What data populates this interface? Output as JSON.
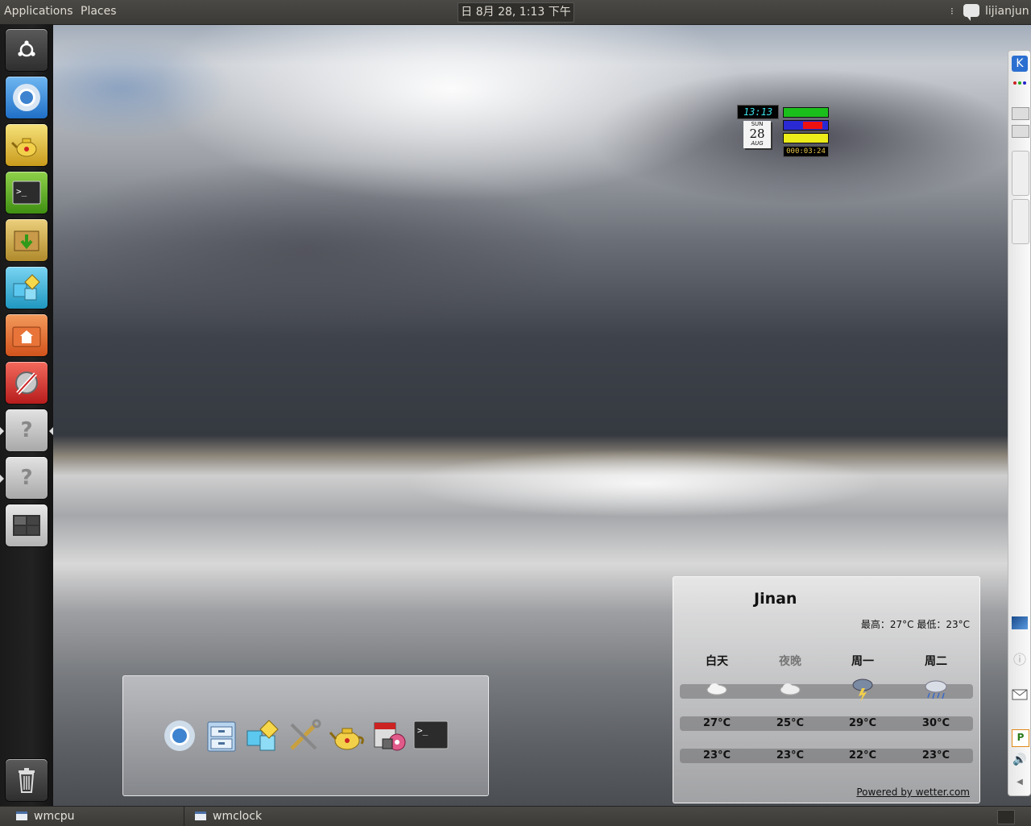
{
  "top_panel": {
    "menu_applications": "Applications",
    "menu_places": "Places",
    "clock": "日 8月 28, 1:13 下午",
    "user": "lijianjun"
  },
  "launcher": {
    "items": [
      {
        "name": "dash-home",
        "icon": "ubuntu-logo-icon"
      },
      {
        "name": "chromium",
        "icon": "chromium-icon"
      },
      {
        "name": "teapot",
        "icon": "teapot-icon"
      },
      {
        "name": "terminal",
        "icon": "terminal-icon"
      },
      {
        "name": "archive-manager",
        "icon": "package-download-icon"
      },
      {
        "name": "workspace-switcher",
        "icon": "shapes-icon"
      },
      {
        "name": "home-folder",
        "icon": "home-folder-icon"
      },
      {
        "name": "settings",
        "icon": "settings-wrench-icon"
      },
      {
        "name": "unknown-app-1",
        "icon": "question-mark-icon"
      },
      {
        "name": "unknown-app-2",
        "icon": "question-mark-icon"
      },
      {
        "name": "workspaces",
        "icon": "workspaces-icon"
      },
      {
        "name": "trash",
        "icon": "trash-icon"
      }
    ]
  },
  "wmclock": {
    "time": "13:13",
    "day": "SUN",
    "date": "28",
    "month": "AUG"
  },
  "wmcpu": {
    "uptime": "000:03:24"
  },
  "dock": {
    "icons": [
      "chromium-icon",
      "file-cabinet-icon",
      "shapes-icon",
      "tools-icon",
      "teapot-icon",
      "software-install-icon",
      "terminal-icon"
    ]
  },
  "weather": {
    "city": "Jinan",
    "hilo": "最高：27°C 最低：23°C",
    "days": [
      {
        "label": "白天",
        "high": "27°C",
        "low": "23°C",
        "icon": "cloudy-icon"
      },
      {
        "label": "夜晚",
        "high": "25°C",
        "low": "23°C",
        "icon": "cloudy-icon"
      },
      {
        "label": "周一",
        "high": "29°C",
        "low": "22°C",
        "icon": "thunderstorm-icon"
      },
      {
        "label": "周二",
        "high": "30°C",
        "low": "23°C",
        "icon": "rain-icon"
      }
    ],
    "powered_by": "Powered by wetter.com"
  },
  "taskbar": {
    "tasks": [
      {
        "label": "wmcpu"
      },
      {
        "label": "wmclock"
      }
    ]
  }
}
